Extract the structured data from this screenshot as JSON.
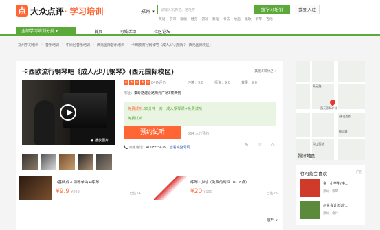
{
  "header": {
    "brand_main": "大众点评",
    "brand_sub": "· 学习培训",
    "logo_char": "点",
    "city": "郑州",
    "search_placeholder": "请输入机构名、地址等",
    "search_button": "搜学习培训",
    "join_button": "我要入驻",
    "hot": [
      "英语",
      "学习",
      "瑜伽",
      "健身",
      "游泳",
      "舞蹈",
      "书法",
      "绘画",
      "唱歌",
      "钢琴",
      "吉他"
    ]
  },
  "nav": {
    "category": "全部学习培训分类",
    "items": [
      "首页",
      "同城活动",
      "社区论坛"
    ]
  },
  "breadcrumb": [
    "郑州学习培训",
    "音乐培训",
    "中原区音乐培训",
    "西元国际音乐培训",
    "卡西欧流行钢琴吧（成人/少儿钢琴）(西元国际校区)"
  ],
  "detail": {
    "title": "卡西欧流行钢琴吧《成人/少儿钢琴》(西元国际校区)",
    "other_branches": "其他2家分店 ›",
    "review_count": "84条评价",
    "scores": [
      "环境：9.0",
      "师资：9.0",
      "效果：9.0"
    ],
    "address_label": "地址：",
    "address": "秦岭路建设路西元广场3楼西侧",
    "promo_line1_tag": "免费试听",
    "promo_line1": "60分钟一对一成人钢琴课+免费试听",
    "promo_line2": "免费试听",
    "trial_button": "预约试听",
    "trial_count": "564 人已预约",
    "phone_label": "商家电话：",
    "phone": "400****429",
    "phone_link": "查看完整号码",
    "video_label": "播放图片"
  },
  "cards": [
    {
      "title": "0基础成人钢琴单曲+练琴",
      "price": "¥9.9",
      "orig": "¥299",
      "sold": "已售141"
    },
    {
      "title": "练琴1小时（免费的时间10-18点）",
      "price": "¥20",
      "orig": "¥100",
      "sold": "已售25"
    }
  ],
  "more": "展开 ∨",
  "map": {
    "labels": [
      "西元国际广场",
      "建设西路",
      "华山西路",
      "开元路",
      "淮河路"
    ],
    "logo": "腾讯地图"
  },
  "side": {
    "title": "你可能会喜欢",
    "ad": "广告",
    "items": [
      {
        "name": "金上小学生(中...",
        "sub": "郑州 · 钢琴"
      },
      {
        "name": "创业会计培训(...",
        "sub": "郑州 · 会计"
      }
    ]
  }
}
